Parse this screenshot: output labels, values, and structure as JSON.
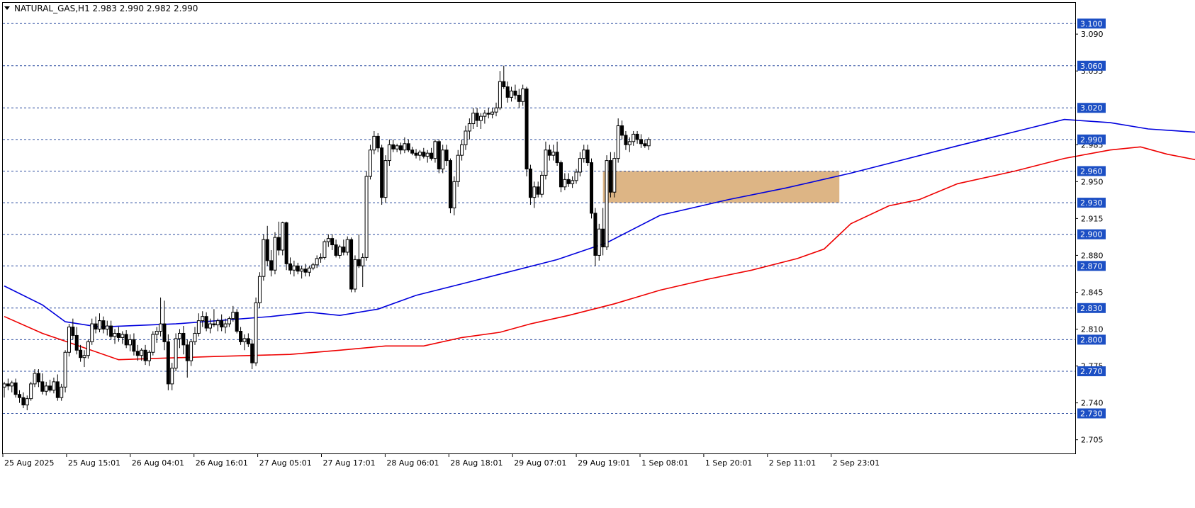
{
  "header": {
    "symbol_line": "NATURAL_GAS,H1  2.983 2.990 2.982 2.990"
  },
  "colors": {
    "ma_fast": "#0000dd",
    "ma_slow": "#ee0000",
    "level_line": "#2f4fa0",
    "level_badge": "#1c4fc4",
    "zone_fill": "#d9ad78"
  },
  "chart_data": {
    "type": "candlestick",
    "y_axis": {
      "min": 2.692,
      "max": 3.117,
      "tick_labels": [
        "3.090",
        "3.055",
        "2.985",
        "2.950",
        "2.915",
        "2.880",
        "2.845",
        "2.810",
        "2.775",
        "2.740",
        "2.705"
      ]
    },
    "levels": [
      "3.100",
      "3.060",
      "3.020",
      "2.990",
      "2.960",
      "2.930",
      "2.900",
      "2.870",
      "2.830",
      "2.800",
      "2.770",
      "2.730"
    ],
    "x_axis": {
      "labels": [
        "25 Aug 2025",
        "25 Aug 15:01",
        "26 Aug 04:01",
        "26 Aug 16:01",
        "27 Aug 05:01",
        "27 Aug 17:01",
        "28 Aug 06:01",
        "28 Aug 18:01",
        "29 Aug 07:01",
        "29 Aug 19:01",
        "1 Sep 08:01",
        "1 Sep 20:01",
        "2 Sep 11:01",
        "2 Sep 23:01"
      ]
    },
    "zone": {
      "from_bar": 157,
      "to_bar": 219,
      "low": 2.93,
      "high": 2.96
    },
    "ma_fast": [
      [
        0,
        2.851
      ],
      [
        10,
        2.833
      ],
      [
        16,
        2.817
      ],
      [
        25,
        2.812
      ],
      [
        45,
        2.815
      ],
      [
        70,
        2.822
      ],
      [
        80,
        2.826
      ],
      [
        88,
        2.823
      ],
      [
        98,
        2.829
      ],
      [
        108,
        2.842
      ],
      [
        120,
        2.853
      ],
      [
        132,
        2.864
      ],
      [
        145,
        2.876
      ],
      [
        158,
        2.892
      ],
      [
        172,
        2.918
      ],
      [
        190,
        2.933
      ],
      [
        205,
        2.944
      ],
      [
        222,
        2.958
      ],
      [
        250,
        2.984
      ],
      [
        268,
        3.0
      ],
      [
        278,
        3.009
      ],
      [
        290,
        3.006
      ],
      [
        300,
        3.0
      ],
      [
        312,
        2.997
      ],
      [
        325,
        2.993
      ],
      [
        333,
        2.986
      ],
      [
        345,
        2.978
      ],
      [
        355,
        2.97
      ],
      [
        368,
        2.968
      ],
      [
        378,
        2.966
      ],
      [
        390,
        2.977
      ],
      [
        400,
        2.983
      ],
      [
        408,
        2.987
      ]
    ],
    "ma_slow": [
      [
        0,
        2.822
      ],
      [
        10,
        2.806
      ],
      [
        18,
        2.796
      ],
      [
        30,
        2.781
      ],
      [
        38,
        2.782
      ],
      [
        55,
        2.784
      ],
      [
        75,
        2.786
      ],
      [
        88,
        2.79
      ],
      [
        100,
        2.794
      ],
      [
        110,
        2.794
      ],
      [
        120,
        2.802
      ],
      [
        130,
        2.807
      ],
      [
        138,
        2.815
      ],
      [
        148,
        2.823
      ],
      [
        160,
        2.834
      ],
      [
        172,
        2.847
      ],
      [
        184,
        2.857
      ],
      [
        196,
        2.866
      ],
      [
        208,
        2.877
      ],
      [
        215,
        2.886
      ],
      [
        222,
        2.91
      ],
      [
        232,
        2.927
      ],
      [
        240,
        2.933
      ],
      [
        250,
        2.948
      ],
      [
        265,
        2.96
      ],
      [
        278,
        2.972
      ],
      [
        290,
        2.98
      ],
      [
        298,
        2.983
      ],
      [
        305,
        2.976
      ],
      [
        315,
        2.969
      ],
      [
        328,
        2.967
      ],
      [
        342,
        2.96
      ],
      [
        355,
        2.957
      ],
      [
        365,
        2.956
      ],
      [
        372,
        2.948
      ],
      [
        380,
        2.94
      ],
      [
        387,
        2.943
      ],
      [
        392,
        2.947
      ],
      [
        405,
        2.953
      ],
      [
        413,
        2.956
      ]
    ],
    "ohlc": [
      [
        2.755,
        2.76,
        2.745,
        2.758
      ],
      [
        2.758,
        2.763,
        2.752,
        2.756
      ],
      [
        2.756,
        2.761,
        2.75,
        2.759
      ],
      [
        2.759,
        2.763,
        2.745,
        2.748
      ],
      [
        2.748,
        2.752,
        2.74,
        2.745
      ],
      [
        2.745,
        2.75,
        2.735,
        2.738
      ],
      [
        2.738,
        2.747,
        2.733,
        2.744
      ],
      [
        2.744,
        2.76,
        2.742,
        2.758
      ],
      [
        2.758,
        2.772,
        2.755,
        2.768
      ],
      [
        2.768,
        2.772,
        2.755,
        2.76
      ],
      [
        2.76,
        2.768,
        2.748,
        2.751
      ],
      [
        2.751,
        2.76,
        2.747,
        2.756
      ],
      [
        2.756,
        2.762,
        2.75,
        2.752
      ],
      [
        2.752,
        2.764,
        2.749,
        2.76
      ],
      [
        2.76,
        2.767,
        2.742,
        2.745
      ],
      [
        2.745,
        2.758,
        2.742,
        2.755
      ],
      [
        2.755,
        2.79,
        2.75,
        2.788
      ],
      [
        2.788,
        2.815,
        2.784,
        2.812
      ],
      [
        2.812,
        2.82,
        2.8,
        2.804
      ],
      [
        2.804,
        2.812,
        2.786,
        2.79
      ],
      [
        2.79,
        2.795,
        2.779,
        2.783
      ],
      [
        2.783,
        2.79,
        2.774,
        2.785
      ],
      [
        2.785,
        2.8,
        2.782,
        2.798
      ],
      [
        2.798,
        2.82,
        2.795,
        2.815
      ],
      [
        2.815,
        2.822,
        2.806,
        2.81
      ],
      [
        2.81,
        2.825,
        2.807,
        2.818
      ],
      [
        2.818,
        2.822,
        2.806,
        2.81
      ],
      [
        2.81,
        2.818,
        2.804,
        2.813
      ],
      [
        2.813,
        2.818,
        2.8,
        2.803
      ],
      [
        2.803,
        2.81,
        2.796,
        2.806
      ],
      [
        2.806,
        2.812,
        2.798,
        2.802
      ],
      [
        2.802,
        2.808,
        2.796,
        2.805
      ],
      [
        2.805,
        2.809,
        2.792,
        2.795
      ],
      [
        2.795,
        2.805,
        2.789,
        2.8
      ],
      [
        2.8,
        2.806,
        2.785,
        2.789
      ],
      [
        2.789,
        2.795,
        2.78,
        2.785
      ],
      [
        2.785,
        2.792,
        2.78,
        2.79
      ],
      [
        2.79,
        2.795,
        2.776,
        2.78
      ],
      [
        2.78,
        2.79,
        2.775,
        2.788
      ],
      [
        2.788,
        2.808,
        2.785,
        2.805
      ],
      [
        2.805,
        2.812,
        2.797,
        2.808
      ],
      [
        2.808,
        2.84,
        2.803,
        2.815
      ],
      [
        2.815,
        2.837,
        2.79,
        2.798
      ],
      [
        2.798,
        2.805,
        2.752,
        2.758
      ],
      [
        2.758,
        2.778,
        2.752,
        2.773
      ],
      [
        2.773,
        2.806,
        2.77,
        2.801
      ],
      [
        2.801,
        2.81,
        2.792,
        2.806
      ],
      [
        2.806,
        2.813,
        2.786,
        2.795
      ],
      [
        2.795,
        2.8,
        2.764,
        2.78
      ],
      [
        2.78,
        2.8,
        2.775,
        2.798
      ],
      [
        2.798,
        2.812,
        2.795,
        2.806
      ],
      [
        2.806,
        2.825,
        2.803,
        2.818
      ],
      [
        2.818,
        2.827,
        2.812,
        2.822
      ],
      [
        2.822,
        2.826,
        2.808,
        2.811
      ],
      [
        2.811,
        2.82,
        2.806,
        2.815
      ],
      [
        2.815,
        2.829,
        2.812,
        2.814
      ],
      [
        2.814,
        2.82,
        2.808,
        2.818
      ],
      [
        2.818,
        2.824,
        2.808,
        2.812
      ],
      [
        2.812,
        2.82,
        2.806,
        2.815
      ],
      [
        2.815,
        2.822,
        2.812,
        2.82
      ],
      [
        2.82,
        2.832,
        2.817,
        2.826
      ],
      [
        2.826,
        2.829,
        2.806,
        2.808
      ],
      [
        2.808,
        2.812,
        2.795,
        2.798
      ],
      [
        2.798,
        2.805,
        2.79,
        2.801
      ],
      [
        2.801,
        2.806,
        2.793,
        2.796
      ],
      [
        2.796,
        2.8,
        2.772,
        2.778
      ],
      [
        2.778,
        2.84,
        2.775,
        2.835
      ],
      [
        2.835,
        2.864,
        2.83,
        2.86
      ],
      [
        2.86,
        2.9,
        2.856,
        2.895
      ],
      [
        2.895,
        2.908,
        2.87,
        2.875
      ],
      [
        2.875,
        2.885,
        2.86,
        2.866
      ],
      [
        2.866,
        2.902,
        2.862,
        2.897
      ],
      [
        2.897,
        2.912,
        2.88,
        2.885
      ],
      [
        2.885,
        2.912,
        2.88,
        2.911
      ],
      [
        2.911,
        2.912,
        2.866,
        2.872
      ],
      [
        2.872,
        2.878,
        2.862,
        2.866
      ],
      [
        2.866,
        2.875,
        2.86,
        2.87
      ],
      [
        2.87,
        2.873,
        2.862,
        2.865
      ],
      [
        2.865,
        2.87,
        2.858,
        2.867
      ],
      [
        2.867,
        2.872,
        2.86,
        2.864
      ],
      [
        2.864,
        2.87,
        2.86,
        2.868
      ],
      [
        2.868,
        2.873,
        2.866,
        2.871
      ],
      [
        2.871,
        2.88,
        2.868,
        2.877
      ],
      [
        2.877,
        2.882,
        2.873,
        2.878
      ],
      [
        2.878,
        2.895,
        2.876,
        2.893
      ],
      [
        2.893,
        2.9,
        2.888,
        2.896
      ],
      [
        2.896,
        2.9,
        2.885,
        2.89
      ],
      [
        2.89,
        2.895,
        2.878,
        2.88
      ],
      [
        2.88,
        2.89,
        2.877,
        2.888
      ],
      [
        2.888,
        2.895,
        2.88,
        2.883
      ],
      [
        2.883,
        2.898,
        2.88,
        2.895
      ],
      [
        2.895,
        2.897,
        2.845,
        2.848
      ],
      [
        2.848,
        2.88,
        2.845,
        2.876
      ],
      [
        2.876,
        2.9,
        2.868,
        2.87
      ],
      [
        2.87,
        2.882,
        2.85,
        2.878
      ],
      [
        2.878,
        2.96,
        2.875,
        2.955
      ],
      [
        2.955,
        2.985,
        2.952,
        2.98
      ],
      [
        2.98,
        2.998,
        2.976,
        2.993
      ],
      [
        2.993,
        2.996,
        2.978,
        2.982
      ],
      [
        2.982,
        2.985,
        2.928,
        2.935
      ],
      [
        2.935,
        2.975,
        2.93,
        2.97
      ],
      [
        2.97,
        2.99,
        2.965,
        2.985
      ],
      [
        2.985,
        2.99,
        2.978,
        2.981
      ],
      [
        2.981,
        2.986,
        2.978,
        2.984
      ],
      [
        2.984,
        2.987,
        2.976,
        2.98
      ],
      [
        2.98,
        2.992,
        2.977,
        2.986
      ],
      [
        2.986,
        2.99,
        2.978,
        2.98
      ],
      [
        2.98,
        2.983,
        2.975,
        2.977
      ],
      [
        2.977,
        2.981,
        2.972,
        2.975
      ],
      [
        2.975,
        2.98,
        2.97,
        2.978
      ],
      [
        2.978,
        2.982,
        2.972,
        2.974
      ],
      [
        2.974,
        2.98,
        2.968,
        2.977
      ],
      [
        2.977,
        2.982,
        2.97,
        2.972
      ],
      [
        2.972,
        2.99,
        2.968,
        2.988
      ],
      [
        2.988,
        2.99,
        2.958,
        2.962
      ],
      [
        2.962,
        2.985,
        2.958,
        2.98
      ],
      [
        2.98,
        2.985,
        2.965,
        2.97
      ],
      [
        2.97,
        2.972,
        2.92,
        2.925
      ],
      [
        2.925,
        2.955,
        2.918,
        2.95
      ],
      [
        2.95,
        2.98,
        2.945,
        2.975
      ],
      [
        2.975,
        2.99,
        2.97,
        2.985
      ],
      [
        2.985,
        3.003,
        2.98,
        2.998
      ],
      [
        2.998,
        3.01,
        2.99,
        3.005
      ],
      [
        3.005,
        3.02,
        3.0,
        3.015
      ],
      [
        3.015,
        3.02,
        3.002,
        3.008
      ],
      [
        3.008,
        3.015,
        3.0,
        3.012
      ],
      [
        3.012,
        3.018,
        3.005,
        3.015
      ],
      [
        3.015,
        3.02,
        3.01,
        3.014
      ],
      [
        3.014,
        3.02,
        3.01,
        3.016
      ],
      [
        3.016,
        3.025,
        3.012,
        3.02
      ],
      [
        3.02,
        3.055,
        3.018,
        3.045
      ],
      [
        3.045,
        3.06,
        3.038,
        3.04
      ],
      [
        3.04,
        3.045,
        3.025,
        3.03
      ],
      [
        3.03,
        3.04,
        3.026,
        3.036
      ],
      [
        3.036,
        3.042,
        3.028,
        3.032
      ],
      [
        3.032,
        3.038,
        3.02,
        3.026
      ],
      [
        3.026,
        3.042,
        3.022,
        3.038
      ],
      [
        3.038,
        3.04,
        2.955,
        2.962
      ],
      [
        2.962,
        2.966,
        2.928,
        2.935
      ],
      [
        2.935,
        2.95,
        2.925,
        2.945
      ],
      [
        2.945,
        2.95,
        2.935,
        2.938
      ],
      [
        2.938,
        2.96,
        2.935,
        2.956
      ],
      [
        2.956,
        2.988,
        2.952,
        2.98
      ],
      [
        2.98,
        2.985,
        2.97,
        2.975
      ],
      [
        2.975,
        2.985,
        2.97,
        2.978
      ],
      [
        2.978,
        2.988,
        2.965,
        2.968
      ],
      [
        2.968,
        2.97,
        2.94,
        2.945
      ],
      [
        2.945,
        2.958,
        2.942,
        2.952
      ],
      [
        2.952,
        2.958,
        2.945,
        2.948
      ],
      [
        2.948,
        2.955,
        2.944,
        2.951
      ],
      [
        2.951,
        2.962,
        2.948,
        2.959
      ],
      [
        2.959,
        2.978,
        2.955,
        2.972
      ],
      [
        2.972,
        2.985,
        2.968,
        2.98
      ],
      [
        2.98,
        2.985,
        2.965,
        2.968
      ],
      [
        2.968,
        2.972,
        2.915,
        2.92
      ],
      [
        2.92,
        2.925,
        2.87,
        2.88
      ],
      [
        2.88,
        2.91,
        2.875,
        2.905
      ],
      [
        2.905,
        2.925,
        2.88,
        2.888
      ],
      [
        2.888,
        2.975,
        2.885,
        2.97
      ],
      [
        2.97,
        2.978,
        2.935,
        2.94
      ],
      [
        2.94,
        2.978,
        2.935,
        2.972
      ],
      [
        2.972,
        3.01,
        2.968,
        3.003
      ],
      [
        3.003,
        3.008,
        2.99,
        2.994
      ],
      [
        2.994,
        2.998,
        2.98,
        2.985
      ],
      [
        2.985,
        2.992,
        2.978,
        2.988
      ],
      [
        2.988,
        2.998,
        2.984,
        2.995
      ],
      [
        2.995,
        2.998,
        2.986,
        2.99
      ],
      [
        2.99,
        2.995,
        2.982,
        2.986
      ],
      [
        2.986,
        2.99,
        2.982,
        2.984
      ],
      [
        2.984,
        2.992,
        2.98,
        2.99
      ]
    ]
  }
}
